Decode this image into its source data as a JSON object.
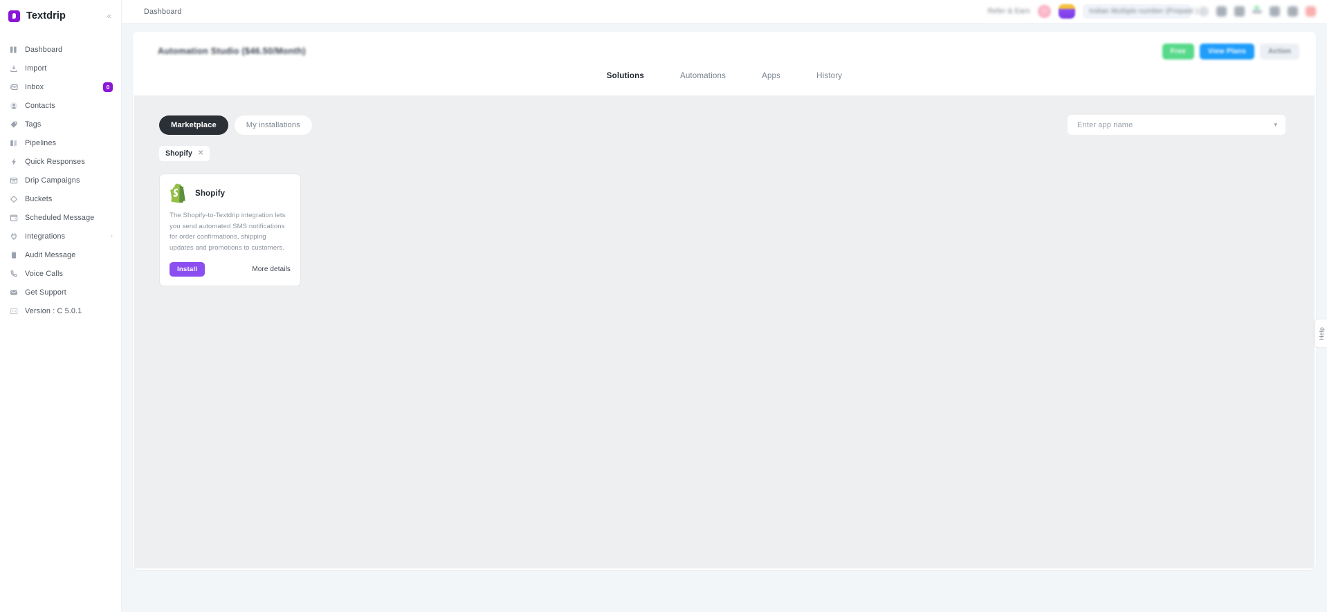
{
  "brand": {
    "name": "Textdrip",
    "logo_icon": "textdrip-logo-icon",
    "collapse_icon": "chevron-double-left-icon",
    "accent": "#8b17d6"
  },
  "sidebar": {
    "items": [
      {
        "label": "Dashboard",
        "icon": "dashboard-icon"
      },
      {
        "label": "Import",
        "icon": "import-icon"
      },
      {
        "label": "Inbox",
        "icon": "inbox-icon",
        "badge": "0"
      },
      {
        "label": "Contacts",
        "icon": "contacts-icon"
      },
      {
        "label": "Tags",
        "icon": "tag-icon"
      },
      {
        "label": "Pipelines",
        "icon": "pipelines-icon"
      },
      {
        "label": "Quick Responses",
        "icon": "bolt-icon"
      },
      {
        "label": "Drip Campaigns",
        "icon": "drip-campaigns-icon"
      },
      {
        "label": "Buckets",
        "icon": "bucket-icon"
      },
      {
        "label": "Scheduled Message",
        "icon": "calendar-icon"
      },
      {
        "label": "Integrations",
        "icon": "plug-icon",
        "chevron": "›"
      },
      {
        "label": "Audit Message",
        "icon": "clipboard-icon"
      },
      {
        "label": "Voice Calls",
        "icon": "voice-call-icon"
      },
      {
        "label": "Get Support",
        "icon": "support-icon"
      },
      {
        "label": "Version : C 5.0.1",
        "icon": "code-icon"
      }
    ]
  },
  "topbar": {
    "breadcrumb": "Dashboard",
    "refer_label": "Refer & Earn",
    "account_pill": "Indian Multiple number (Prepaid )",
    "icons": [
      "refresh-icon",
      "notification-bell-icon",
      "chat-icon",
      "toggle-icon",
      "user-icon",
      "settings-gear-icon",
      "logout-icon"
    ]
  },
  "page": {
    "title": "Automation Studio ($46.50/Month)",
    "actions": [
      {
        "label": "Free",
        "style": "green",
        "name": "plan-badge-button"
      },
      {
        "label": "View Plans",
        "style": "blue",
        "name": "view-plans-button"
      },
      {
        "label": "Action",
        "style": "gray",
        "name": "action-dropdown-button"
      }
    ],
    "tabs": [
      {
        "label": "Solutions",
        "active": true
      },
      {
        "label": "Automations",
        "active": false
      },
      {
        "label": "Apps",
        "active": false
      },
      {
        "label": "History",
        "active": false
      }
    ]
  },
  "marketplace": {
    "segments": [
      {
        "label": "Marketplace",
        "active": true
      },
      {
        "label": "My installations",
        "active": false
      }
    ],
    "search": {
      "placeholder": "Enter app name",
      "chevron_icon": "chevron-down-icon"
    },
    "filter_chips": [
      {
        "label": "Shopify",
        "remove_icon": "close-icon"
      }
    ],
    "apps": [
      {
        "name": "Shopify",
        "icon": "shopify-logo-icon",
        "description": "The Shopify-to-Textdrip integration lets you send automated SMS notifications for order confirmations, shipping updates and promotions to customers.",
        "install_label": "Install",
        "details_label": "More details"
      }
    ]
  },
  "help_tab": {
    "label": "Help"
  }
}
